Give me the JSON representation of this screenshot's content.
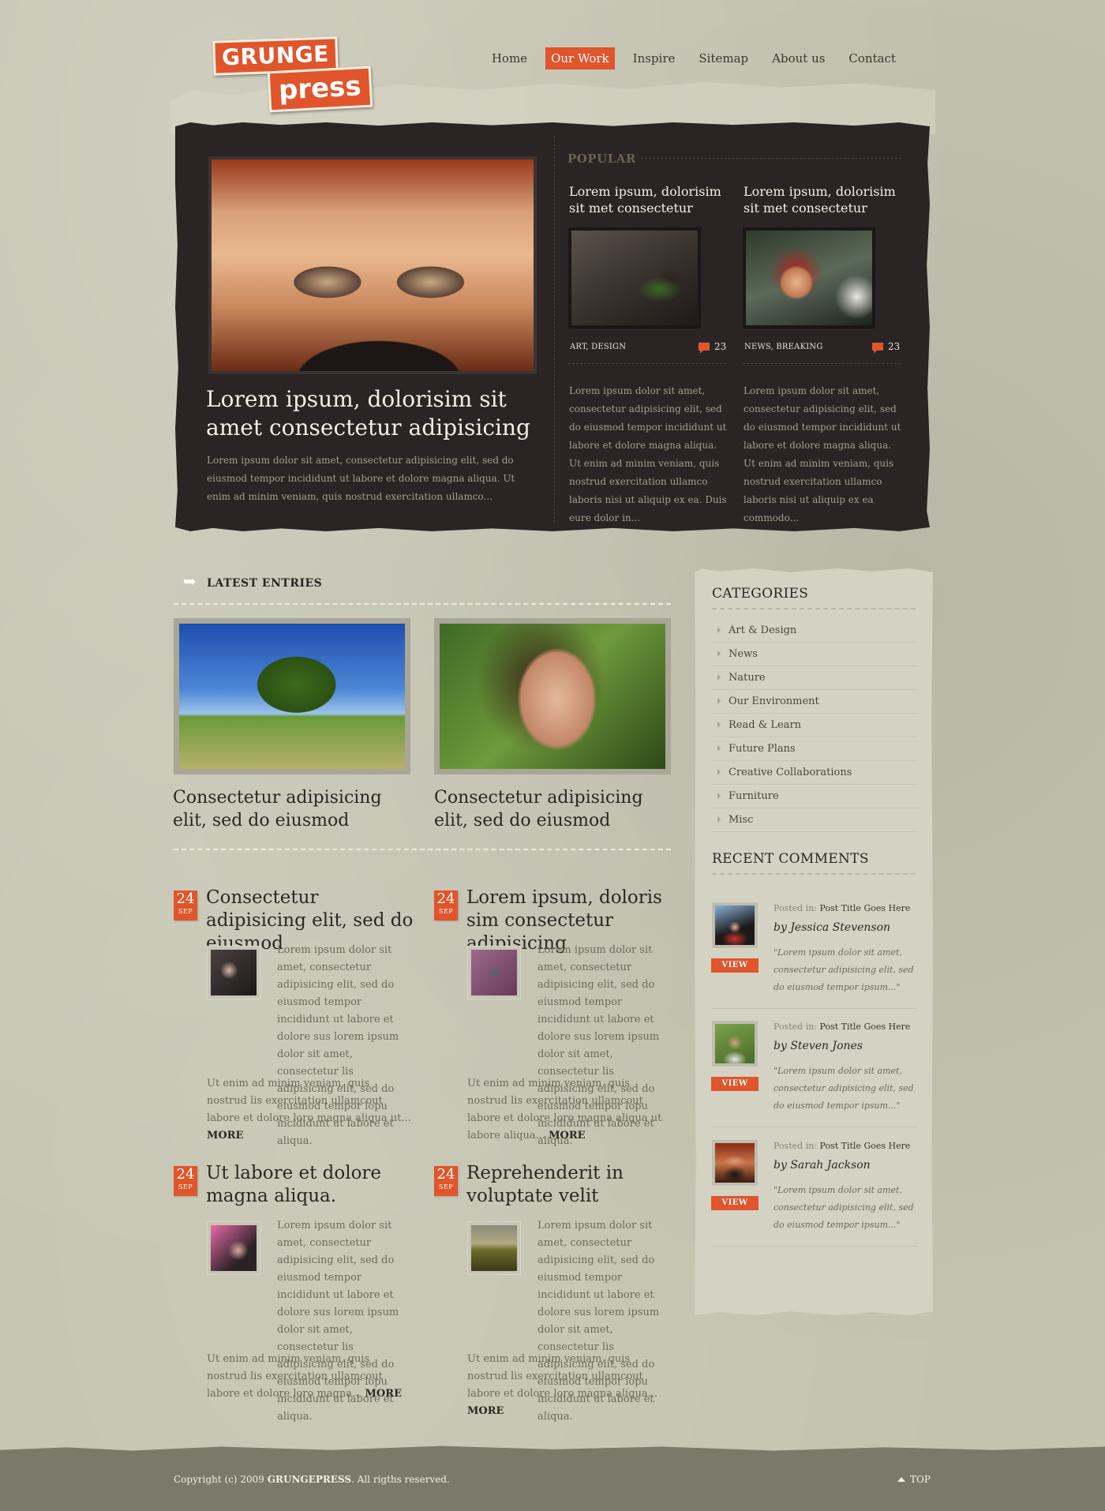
{
  "logo": {
    "line1": "GRUNGE",
    "line2": "press"
  },
  "nav": {
    "items": [
      "Home",
      "Our Work",
      "Inspire",
      "Sitemap",
      "About us",
      "Contact"
    ],
    "active": "Our Work"
  },
  "feature": {
    "title": "Lorem ipsum, dolorisim sit amet consectetur adipisicing",
    "text": "Lorem ipsum dolor sit amet, consectetur adipisicing elit, sed do eiusmod tempor incididunt ut labore et dolore magna aliqua. Ut enim ad minim veniam, quis nostrud exercitation ullamco..."
  },
  "popular": {
    "label": "POPULAR",
    "items": [
      {
        "title": "Lorem ipsum, dolorisim sit met consectetur",
        "tags": "ART, DESIGN",
        "comments": "23",
        "text": "Lorem ipsum dolor sit amet, consectetur adipisicing elit, sed do eiusmod tempor incididunt ut labore et dolore magna aliqua. Ut enim ad minim veniam, quis nostrud exercitation ullamco laboris nisi ut aliquip ex ea. Duis eure dolor in..."
      },
      {
        "title": "Lorem ipsum, dolorisim sit met consectetur",
        "tags": "NEWS, BREAKING",
        "comments": "23",
        "text": "Lorem ipsum dolor sit amet, consectetur adipisicing elit, sed do eiusmod tempor incididunt ut labore et dolore magna aliqua. Ut enim ad minim veniam, quis nostrud exercitation ullamco laboris nisi ut aliquip ex ea commodo..."
      }
    ]
  },
  "latest": {
    "label": "LATEST ENTRIES",
    "featured": [
      {
        "title": "Consectetur adipisicing elit, sed do eiusmod"
      },
      {
        "title": "Consectetur adipisicing elit, sed do eiusmod"
      }
    ],
    "posts": [
      {
        "day": "24",
        "month": "SEP",
        "title": "Consectetur adipisicing elit, sed do eiusmod",
        "p1": "Lorem ipsum dolor sit amet, consectetur adipisicing elit, sed do eiusmod tempor incididunt ut labore et dolore sus lorem ipsum dolor sit amet, consectetur lis adipisicing elit, sed do eiusmod tempor lopu incididunt ut labore et aliqua.",
        "p2": "Ut enim ad minim veniam, quis nostrud lis exercitation ullamcout labore et dolore loro magna aliqua ut...",
        "more": "MORE"
      },
      {
        "day": "24",
        "month": "SEP",
        "title": "Lorem ipsum, doloris sim consectetur adipisicing",
        "p1": "Lorem ipsum dolor sit amet, consectetur adipisicing elit, sed do eiusmod tempor incididunt ut labore et dolore sus lorem ipsum dolor sit amet, consectetur lis adipisicing elit, sed do eiusmod tempor lopu incididunt ut labore et aliqua.",
        "p2": "Ut enim ad minim veniam, quis nostrud lis exercitation ullamcout labore et dolore loro magna aliqua ut labore aliqua...",
        "more": "MORE"
      },
      {
        "day": "24",
        "month": "SEP",
        "title": "Ut labore et dolore magna aliqua.",
        "p1": "Lorem ipsum dolor sit amet, consectetur adipisicing elit, sed do eiusmod tempor incididunt ut labore et dolore sus lorem ipsum dolor sit amet, consectetur lis adipisicing elit, sed do eiusmod tempor lopu incididunt ut labore et aliqua.",
        "p2": "Ut enim ad minim veniam, quis nostrud lis exercitation ullamcout labore et dolore loro magna...",
        "more": "MORE"
      },
      {
        "day": "24",
        "month": "SEP",
        "title": "Reprehenderit in voluptate velit",
        "p1": "Lorem ipsum dolor sit amet, consectetur adipisicing elit, sed do eiusmod tempor incididunt ut labore et dolore sus lorem ipsum dolor sit amet, consectetur lis adipisicing elit, sed do eiusmod tempor lopu incididunt ut labore et aliqua.",
        "p2": "Ut enim ad minim veniam, quis nostrud lis exercitation ullamcout labore et dolore loro magna aliqua...",
        "more": "MORE"
      }
    ]
  },
  "sidebar": {
    "categories_label": "CATEGORIES",
    "categories": [
      "Art & Design",
      "News",
      "Nature",
      "Our Environment",
      "Read & Learn",
      "Future Plans",
      "Creative Collaborations",
      "Furniture",
      "Misc"
    ],
    "comments_label": "RECENT COMMENTS",
    "comments": [
      {
        "posted_in": "Posted in:",
        "post": "Post Title Goes Here",
        "by": "by Jessica Stevenson",
        "quote": "\"Lorem ipsum dolor sit amet, consectetur adipisicing elit, sed do eiusmod tempor ipsum...\"",
        "view": "VIEW"
      },
      {
        "posted_in": "Posted in:",
        "post": "Post Title Goes Here",
        "by": "by Steven Jones",
        "quote": "\"Lorem ipsum dolor sit amet, consectetur adipisicing elit, sed do eiusmod tempor ipsum...\"",
        "view": "VIEW"
      },
      {
        "posted_in": "Posted in:",
        "post": "Post Title Goes Here",
        "by": "by Sarah Jackson",
        "quote": "\"Lorem ipsum dolor sit amet, consectetur adipisicing elit, sed do eiusmod tempor ipsum...\"",
        "view": "VIEW"
      }
    ]
  },
  "footer": {
    "copyright_prefix": "Copyright (c) 2009",
    "brand": "GRUNGEPRESS",
    "copyright_suffix": ". All rigths reserved.",
    "top": "TOP"
  },
  "colors": {
    "accent": "#e0552b",
    "dark_panel": "#2a2524",
    "background": "#c4c3b0",
    "footer": "#7b7969"
  }
}
